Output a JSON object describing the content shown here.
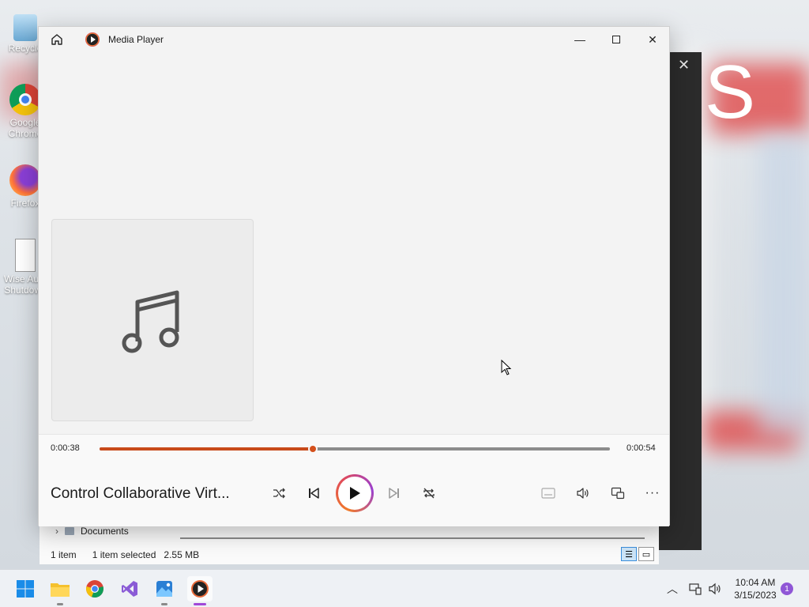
{
  "desktop": {
    "icons": [
      {
        "label": "Recycle",
        "name": "recycle-bin"
      },
      {
        "label": "Google Chrome",
        "name": "google-chrome"
      },
      {
        "label": "Firefox",
        "name": "firefox"
      },
      {
        "label": "Wise Auto Shutdown",
        "name": "wise-auto-shutdown"
      }
    ]
  },
  "player": {
    "title": "Media Player",
    "track_title": "Control Collaborative Virt...",
    "elapsed": "0:00:38",
    "duration": "0:00:54",
    "progress": 0.418,
    "accent_color": "#c84a1a"
  },
  "explorer": {
    "folder_label": "Documents",
    "item_count": "1 item",
    "selection": "1 item selected",
    "size": "2.55 MB"
  },
  "taskbar": {
    "apps": [
      "start-icon",
      "file-explorer-icon",
      "chrome-icon",
      "visual-studio-icon",
      "photos-icon",
      "media-player-icon"
    ],
    "time": "10:04 AM",
    "date": "3/15/2023",
    "notification_count": "1"
  },
  "dark_panel": {
    "big_letter": "S"
  }
}
